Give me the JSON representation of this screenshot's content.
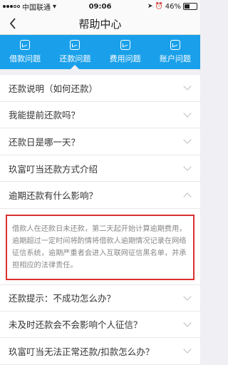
{
  "status_bar": {
    "carrier": "中国联通",
    "time": "09:06",
    "battery": "46%"
  },
  "header": {
    "title": "帮助中心"
  },
  "tabs": [
    {
      "label": "借款问题",
      "active": false
    },
    {
      "label": "还款问题",
      "active": true
    },
    {
      "label": "费用问题",
      "active": false
    },
    {
      "label": "账户问题",
      "active": false
    }
  ],
  "questions": [
    "还款说明（如何还款）",
    "我能提前还款吗？",
    "还款日是哪一天？",
    "玖富叮当还款方式介绍",
    "逾期还款有什么影响？",
    "还款提示：不成功怎么办？",
    "未及时还款会不会影响个人征信？",
    "玖富叮当无法正常还款/扣款怎么办？"
  ],
  "expanded_answer": "借款人在还款日未还款，第二天起开始计算逾期费用，逾期超过一定时间将酌情将借款人逾期情况记录在网络征信系统，逾期严重者会进入互联网征信黑名单，并承担相应的法律责任。",
  "colors": {
    "tab_bar": "#1aa0ea",
    "highlight_border": "#d93030"
  }
}
